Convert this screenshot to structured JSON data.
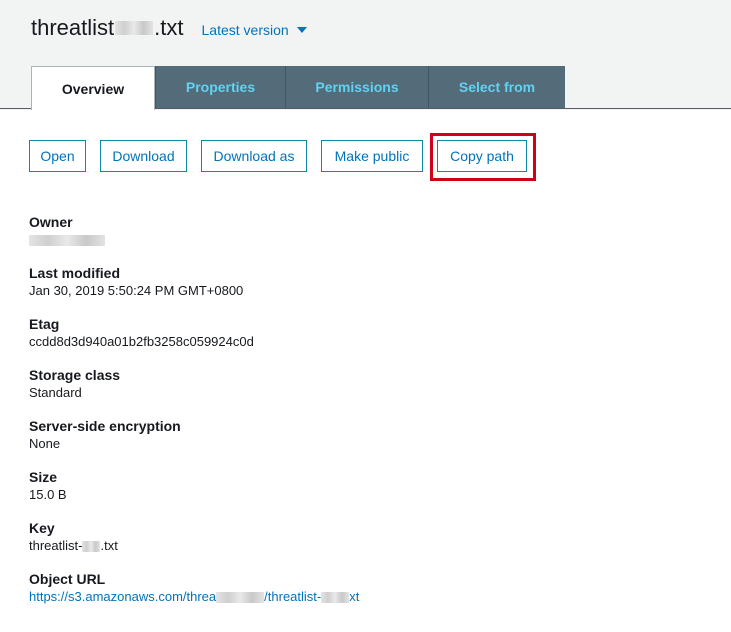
{
  "header": {
    "title_prefix": "threatlist",
    "title_suffix": ".txt",
    "version_label": "Latest version"
  },
  "tabs": [
    {
      "label": "Overview",
      "active": true
    },
    {
      "label": "Properties",
      "active": false
    },
    {
      "label": "Permissions",
      "active": false
    },
    {
      "label": "Select from",
      "active": false
    }
  ],
  "actions": {
    "open": "Open",
    "download": "Download",
    "download_as": "Download as",
    "make_public": "Make public",
    "copy_path": "Copy path"
  },
  "fields": {
    "owner": {
      "label": "Owner"
    },
    "last_modified": {
      "label": "Last modified",
      "value": "Jan 30, 2019 5:50:24 PM GMT+0800"
    },
    "etag": {
      "label": "Etag",
      "value": "ccdd8d3d940a01b2fb3258c059924c0d"
    },
    "storage_class": {
      "label": "Storage class",
      "value": "Standard"
    },
    "encryption": {
      "label": "Server-side encryption",
      "value": "None"
    },
    "size": {
      "label": "Size",
      "value": "15.0 B"
    },
    "key": {
      "label": "Key",
      "value_prefix": "threatlist-",
      "value_suffix": ".txt"
    },
    "object_url": {
      "label": "Object URL",
      "part1": "https://s3.amazonaws.com/threa",
      "part2": "/threatlist-",
      "part3": "xt"
    }
  },
  "colors": {
    "link": "#0073bb",
    "tab_inactive_bg": "#546b7a",
    "tab_inactive_text": "#5fd3f3",
    "highlight": "#d0021b"
  }
}
